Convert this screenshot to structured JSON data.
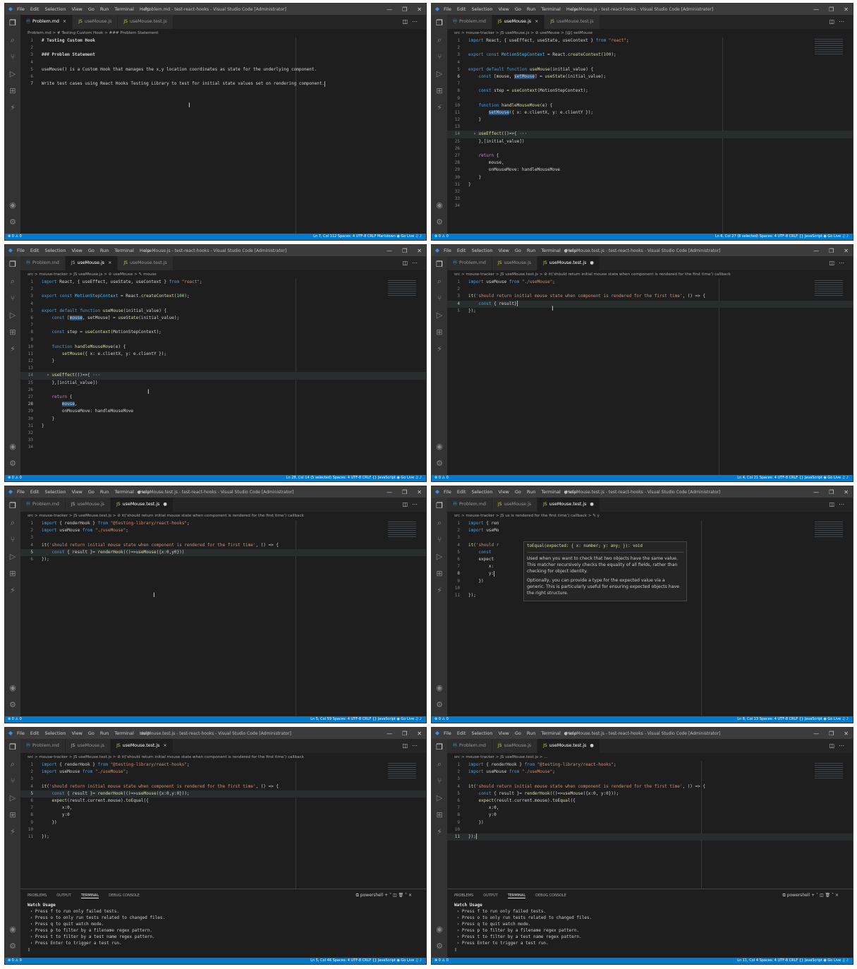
{
  "menu": [
    "File",
    "Edit",
    "Selection",
    "View",
    "Go",
    "Run",
    "Terminal",
    "Help"
  ],
  "panels": [
    {
      "title": "Problem.md - test-react-hooks - Visual Studio Code [Administrator]",
      "tabs": [
        {
          "label": "Problem.md",
          "type": "md",
          "active": true,
          "close": "×"
        },
        {
          "label": "useMouse.js",
          "type": "js",
          "active": false,
          "close": ""
        },
        {
          "label": "useMouse.test.js",
          "type": "js",
          "active": false,
          "close": ""
        }
      ],
      "breadcrumb": "Problem.md > # Testing Custom Hook > ### Problem Statement",
      "ruler": 390,
      "lines": [
        {
          "n": "1",
          "t": "# Testing Custom Hook",
          "c": "mdh"
        },
        {
          "n": "2",
          "t": ""
        },
        {
          "n": "3",
          "t": "### Problem Statement",
          "c": "mdh"
        },
        {
          "n": "4",
          "t": ""
        },
        {
          "n": "5",
          "t": "useMouse() is a Custom Hook that manages the x,y location coordinates as state for the underlying component."
        },
        {
          "n": "6",
          "t": ""
        },
        {
          "n": "7",
          "t": "Write test cases using React Hooks Testing Library to test for initial state values set on rendering component.",
          "cur": true,
          "caret": true
        }
      ],
      "status_left": "⊗ 0 ⚠ 0",
      "status_right": "Ln 7, Col 112   Spaces: 4   UTF-8   CRLF   Markdown   ◉ Go Live   ♫   ♪",
      "ibeam": [
        260,
        140
      ]
    },
    {
      "title": "useMouse.js - test-react-hooks - Visual Studio Code [Administrator]",
      "tabs": [
        {
          "label": "Problem.md",
          "type": "md",
          "active": false,
          "close": ""
        },
        {
          "label": "useMouse.js",
          "type": "js",
          "active": true,
          "close": "×"
        },
        {
          "label": "useMouse.test.js",
          "type": "js",
          "active": false,
          "close": ""
        }
      ],
      "breadcrumb": "src > mouse-tracker > JS useMouse.js > ⊘ useMouse > [@] setMouse",
      "ruler": 390,
      "lines": [
        {
          "n": "1",
          "h": "<span class='kw'>import</span> React, { useEffect, useState, useContext } <span class='kw'>from</span> <span class='str'>\"react\"</span>;"
        },
        {
          "n": "2",
          "t": ""
        },
        {
          "n": "3",
          "h": "<span class='kw'>export</span> <span class='kw'>const</span> <span class='cls'>MotionStepContext</span> = React.<span class='fn'>createContext</span>(<span class='num'>100</span>);"
        },
        {
          "n": "4",
          "t": ""
        },
        {
          "n": "5",
          "h": "<span class='kw'>export</span> <span class='kw'>default</span> <span class='kw'>function</span> <span class='fn'>useMouse</span>(initial_value) {"
        },
        {
          "n": "6",
          "cur": true,
          "h": "    <span class='kw'>const</span> [mouse, <span class='sel'>setMouse</span>] = <span class='fn'>useState</span>(initial_value);"
        },
        {
          "n": "7",
          "t": ""
        },
        {
          "n": "8",
          "h": "    <span class='kw'>const</span> step = <span class='fn'>useContext</span>(MotionStepContext);"
        },
        {
          "n": "9",
          "t": ""
        },
        {
          "n": "10",
          "h": "    <span class='kw'>function</span> <span class='fn'>handleMouseMove</span>(e) {"
        },
        {
          "n": "11",
          "h": "        <span class='sel'>setMouse</span>({ x: e.clientX, y: e.clientY });"
        },
        {
          "n": "12",
          "t": "    }"
        },
        {
          "n": "13",
          "t": ""
        },
        {
          "n": "14",
          "hl": true,
          "h": "  › <span class='fn'>useEffect</span>(()=>{ ···"
        },
        {
          "n": "25",
          "t": "    },[initial_value])"
        },
        {
          "n": "26",
          "t": ""
        },
        {
          "n": "27",
          "h": "    <span class='ctl2'>return</span> {"
        },
        {
          "n": "28",
          "t": "        mouse,"
        },
        {
          "n": "29",
          "t": "        onMouseMove: handleMouseMove"
        },
        {
          "n": "30",
          "t": "    }"
        },
        {
          "n": "31",
          "t": "}"
        },
        {
          "n": "32",
          "t": ""
        },
        {
          "n": "33",
          "t": ""
        },
        {
          "n": "34",
          "t": ""
        }
      ],
      "status_left": "⊗ 0 ⚠ 0",
      "status_right": "Ln 6, Col 27 (8 selected)   Spaces: 4   UTF-8   CRLF   {} JavaScript   ◉ Go Live   ♫   ♪",
      "minimap": true
    },
    {
      "title": "useMouse.js - test-react-hooks - Visual Studio Code [Administrator]",
      "tabs": [
        {
          "label": "Problem.md",
          "type": "md",
          "active": false,
          "close": ""
        },
        {
          "label": "useMouse.js",
          "type": "js",
          "active": true,
          "close": "×"
        },
        {
          "label": "useMouse.test.js",
          "type": "js",
          "active": false,
          "close": ""
        }
      ],
      "breadcrumb": "src > mouse-tracker > JS useMouse.js > ⊘ useMouse > ✎ mouse",
      "ruler": 390,
      "lines": [
        {
          "n": "1",
          "h": "<span class='kw'>import</span> React, { useEffect, useState, useContext } <span class='kw'>from</span> <span class='str'>\"react\"</span>;"
        },
        {
          "n": "2",
          "t": ""
        },
        {
          "n": "3",
          "h": "<span class='kw'>export</span> <span class='kw'>const</span> <span class='cls'>MotionStepContext</span> = React.<span class='fn'>createContext</span>(<span class='num'>100</span>);"
        },
        {
          "n": "4",
          "t": ""
        },
        {
          "n": "5",
          "h": "<span class='kw'>export</span> <span class='kw'>default</span> <span class='kw'>function</span> <span class='fn'>useMouse</span>(initial_value) {"
        },
        {
          "n": "6",
          "h": "    <span class='kw'>const</span> [<span class='sel'>mouse</span>, setMouse] = <span class='fn'>useState</span>(initial_value);"
        },
        {
          "n": "7",
          "t": ""
        },
        {
          "n": "8",
          "h": "    <span class='kw'>const</span> step = <span class='fn'>useContext</span>(MotionStepContext);"
        },
        {
          "n": "9",
          "t": ""
        },
        {
          "n": "10",
          "h": "    <span class='kw'>function</span> <span class='fn'>handleMouseMove</span>(e) {"
        },
        {
          "n": "11",
          "h": "        <span class='fn'>setMouse</span>({ x: e.clientX, y: e.clientY });"
        },
        {
          "n": "12",
          "t": "    }"
        },
        {
          "n": "13",
          "t": ""
        },
        {
          "n": "14",
          "hl": true,
          "h": "  › <span class='fn'>useEffect</span>(()=>{ ···"
        },
        {
          "n": "25",
          "t": "    },[initial_value])"
        },
        {
          "n": "26",
          "t": ""
        },
        {
          "n": "27",
          "h": "    <span class='ctl2'>return</span> {"
        },
        {
          "n": "28",
          "cur": true,
          "h": "        <span class='sel'>mouse</span>,"
        },
        {
          "n": "29",
          "t": "        onMouseMove: handleMouseMove"
        },
        {
          "n": "30",
          "t": "    }"
        },
        {
          "n": "31",
          "t": "}"
        },
        {
          "n": "32",
          "t": ""
        },
        {
          "n": "33",
          "t": ""
        },
        {
          "n": "34",
          "t": ""
        }
      ],
      "status_left": "⊗ 0 ⚠ 0",
      "status_right": "Ln 28, Col 14 (5 selected)   Spaces: 4   UTF-8   CRLF   {} JavaScript   ◉ Go Live   ♫   ♪",
      "minimap": true,
      "ibeam": [
        202,
        204
      ]
    },
    {
      "title": "● useMouse.test.js - test-react-hooks - Visual Studio Code [Administrator]",
      "tabs": [
        {
          "label": "Problem.md",
          "type": "md",
          "active": false,
          "close": ""
        },
        {
          "label": "useMouse.js",
          "type": "js",
          "active": false,
          "close": ""
        },
        {
          "label": "useMouse.test.js",
          "type": "js",
          "active": true,
          "close": "●"
        }
      ],
      "breadcrumb": "src > mouse-tracker > JS useMouse.test.js > ⊘ it('should return initial mouse state when component is rendered for the first time') callback",
      "ruler": 385,
      "lines": [
        {
          "n": "1",
          "h": "<span class='kw'>import</span> useMouse <span class='kw'>from</span> <span class='str'>\"./useMouse\"</span>;"
        },
        {
          "n": "2",
          "t": ""
        },
        {
          "n": "3",
          "h": "<span class='fn'>it</span>(<span class='str'>'should return initial mouse state when component is rendered for the first time'</span>, () => {"
        },
        {
          "n": "4",
          "cur": true,
          "hl": true,
          "caret": true,
          "h": "    <span class='kw'>const</span> { result}"
        },
        {
          "n": "5",
          "t": "});"
        }
      ],
      "status_left": "⊗ 0 ⚠ 0",
      "status_right": "Ln 4, Col 21   Spaces: 4   UTF-8   CRLF   {} JavaScript   ◉ Go Live   ♫   ♪",
      "minimap": true,
      "ibeam": [
        170,
        86
      ]
    },
    {
      "title": "● useMouse.test.js - test-react-hooks - Visual Studio Code [Administrator]",
      "tabs": [
        {
          "label": "Problem.md",
          "type": "md",
          "active": false,
          "close": ""
        },
        {
          "label": "useMouse.js",
          "type": "js",
          "active": false,
          "close": ""
        },
        {
          "label": "useMouse.test.js",
          "type": "js",
          "active": true,
          "close": "●"
        }
      ],
      "breadcrumb": "src > mouse-tracker > JS useMouse.test.js > ⊘ it('should return initial mouse state when component is rendered for the first time') callback",
      "ruler": 390,
      "lines": [
        {
          "n": "1",
          "h": "<span class='kw'>import</span> { renderHook } <span class='kw'>from</span> <span class='str'>\"@testing-library/react-hooks\"</span>;"
        },
        {
          "n": "2",
          "h": "<span class='kw'>import</span> useMouse <span class='kw'>from</span> <span class='str'>\"./useMouse\"</span>;"
        },
        {
          "n": "3",
          "t": ""
        },
        {
          "n": "4",
          "h": "<span class='fn'>it</span>(<span class='str'>'should return initial mouse state when component is rendered for the first time'</span>, () => {"
        },
        {
          "n": "5",
          "cur": true,
          "hl": true,
          "h": "    <span class='kw'>const</span> { result }= <span class='fn'>renderHook</span>(()=><span class='fn'>useMouse</span>({x:0,y0}))"
        },
        {
          "n": "6",
          "t": "});"
        }
      ],
      "status_left": "⊗ 0 ⚠ 0",
      "status_right": "Ln 5, Col 59   Spaces: 4   UTF-8   CRLF   {} JavaScript   ◉ Go Live   ♫   ♪",
      "minimap": true,
      "ibeam": [
        210,
        150
      ]
    },
    {
      "title": "● useMouse.test.js - test-react-hooks - Visual Studio Code [Administrator]",
      "tabs": [
        {
          "label": "Problem.md",
          "type": "md",
          "active": false,
          "close": ""
        },
        {
          "label": "useMouse.js",
          "type": "js",
          "active": false,
          "close": ""
        },
        {
          "label": "useMouse.test.js",
          "type": "js",
          "active": true,
          "close": "●"
        }
      ],
      "breadcrumb": "src > mouse-tracker > JS us                                                                                  is rendered for the first time') callback > ✎ y",
      "ruler": 360,
      "lines": [
        {
          "n": "1",
          "h": "<span class='kw'>import</span> { ren"
        },
        {
          "n": "2",
          "h": "<span class='kw'>import</span> useMo"
        },
        {
          "n": "3",
          "t": ""
        },
        {
          "n": "4",
          "h": "<span class='fn'>it</span>(<span class='str'>'should r                                              the first time'</span>, () => {"
        },
        {
          "n": "5",
          "h": "    <span class='kw'>const</span>"
        },
        {
          "n": "6",
          "h": "    expect"
        },
        {
          "n": "7",
          "t": "        x:"
        },
        {
          "n": "8",
          "cur": true,
          "caret": true,
          "t": "        y:"
        },
        {
          "n": "9",
          "t": "    })"
        },
        {
          "n": "10",
          "t": ""
        },
        {
          "n": "11",
          "t": "});"
        }
      ],
      "hover": {
        "signature": "toEqual(expected: { x: number; y: any; }): void",
        "p1": "Used when you want to check that two objects have the same value. This matcher recursively checks the equality of all fields, rather than checking for object identity.",
        "p2": "Optionally, you can provide a type for the expected value via a generic. This is particularly useful for ensuring expected objects have the right structure."
      },
      "status_left": "⊗ 0 ⚠ 0",
      "status_right": "Ln 8, Col 13   Spaces: 4   UTF-8   CRLF   {} JavaScript   ◉ Go Live   ♫   ♪",
      "minimap": true
    },
    {
      "title": "useMouse.test.js - test-react-hooks - Visual Studio Code [Administrator]",
      "tabs": [
        {
          "label": "Problem.md",
          "type": "md",
          "active": false,
          "close": ""
        },
        {
          "label": "useMouse.js",
          "type": "js",
          "active": false,
          "close": ""
        },
        {
          "label": "useMouse.test.js",
          "type": "js",
          "active": true,
          "close": "×"
        }
      ],
      "breadcrumb": "src > mouse-tracker > JS useMouse.test.js > ⊘ it('should return initial mouse state when component is rendered for the first time') callback",
      "ruler": 390,
      "lines": [
        {
          "n": "1",
          "h": "<span class='kw'>import</span> { renderHook } <span class='kw'>from</span> <span class='str'>\"@testing-library/react-hooks\"</span>;"
        },
        {
          "n": "2",
          "h": "<span class='kw'>import</span> useMouse <span class='kw'>from</span> <span class='str'>\"./useMouse\"</span>;"
        },
        {
          "n": "3",
          "t": ""
        },
        {
          "n": "4",
          "h": "<span class='fn'>it</span>(<span class='str'>'should return initial mouse state when component is rendered for the first time'</span>, () => {"
        },
        {
          "n": "5",
          "cur": true,
          "hl": true,
          "h": "    <span class='kw'>const</span> { result }= <span class='fn'>renderHook</span>(()=><span class='fn'>useMouse</span>({x:0,y:0}));"
        },
        {
          "n": "6",
          "h": "    <span class='fn'>expect</span>(result.current.mouse).<span class='fn'>toEqual</span>({"
        },
        {
          "n": "7",
          "t": "        x:0,"
        },
        {
          "n": "8",
          "t": "        y:0"
        },
        {
          "n": "9",
          "t": "    })"
        },
        {
          "n": "10",
          "t": ""
        },
        {
          "n": "11",
          "t": "});"
        }
      ],
      "terminal": {
        "tabs": [
          "PROBLEMS",
          "OUTPUT",
          "TERMINAL",
          "DEBUG CONSOLE"
        ],
        "shell": "⧉ powershell  + ˅  ◫  🗑  ˄  ×",
        "lines": [
          "Watch Usage",
          " › Press f to run only failed tests.",
          " › Press o to only run tests related to changed files.",
          " › Press q to quit watch mode.",
          " › Press p to filter by a filename regex pattern.",
          " › Press t to filter by a test name regex pattern.",
          " › Press Enter to trigger a test run.",
          "▯"
        ]
      },
      "status_left": "⊗ 0 ⚠ 0",
      "status_right": "Ln 5, Col 46   Spaces: 4   UTF-8   CRLF   {} JavaScript   ◉ Go Live   ♫   ♪",
      "minimap": true
    },
    {
      "title": "● useMouse.test.js - test-react-hooks - Visual Studio Code [Administrator]",
      "tabs": [
        {
          "label": "Problem.md",
          "type": "md",
          "active": false,
          "close": ""
        },
        {
          "label": "useMouse.js",
          "type": "js",
          "active": false,
          "close": ""
        },
        {
          "label": "useMouse.test.js",
          "type": "js",
          "active": true,
          "close": "●"
        }
      ],
      "breadcrumb": "src > mouse-tracker > JS useMouse.test.js > ...",
      "ruler": 360,
      "lines": [
        {
          "n": "1",
          "h": "<span class='kw'>import</span> { renderHook } <span class='kw'>from</span> <span class='str'>\"@testing-library/react-hooks\"</span>;"
        },
        {
          "n": "2",
          "h": "<span class='kw'>import</span> useMouse <span class='kw'>from</span> <span class='str'>\"./useMouse\"</span>;"
        },
        {
          "n": "3",
          "t": ""
        },
        {
          "n": "4",
          "h": "<span class='fn'>it</span>(<span class='str'>'should return initial mouse state when component is rendered for the first time'</span>, () => {"
        },
        {
          "n": "5",
          "h": "    <span class='kw'>const</span> { result }= <span class='fn'>renderHook</span>(()=><span class='fn'>useMouse</span>({x:0, y:0}));"
        },
        {
          "n": "6",
          "h": "    <span class='fn'>expect</span>(result.current.mouse).<span class='fn'>toEqual</span>({"
        },
        {
          "n": "7",
          "t": "        x:0,"
        },
        {
          "n": "8",
          "t": "        y:0"
        },
        {
          "n": "9",
          "t": "    })"
        },
        {
          "n": "10",
          "t": ""
        },
        {
          "n": "11",
          "cur": true,
          "hl": true,
          "caret": true,
          "t": "});"
        }
      ],
      "terminal": {
        "tabs": [
          "PROBLEMS",
          "OUTPUT",
          "TERMINAL",
          "DEBUG CONSOLE"
        ],
        "shell": "⧉ powershell  + ˅  ◫  🗑  ˄  ×",
        "lines": [
          "Watch Usage",
          " › Press f to run only failed tests.",
          " › Press o to only run tests related to changed files.",
          " › Press q to quit watch mode.",
          " › Press p to filter by a filename regex pattern.",
          " › Press t to filter by a test name regex pattern.",
          " › Press Enter to trigger a test run.",
          "▯"
        ]
      },
      "status_left": "⊗ 0 ⚠ 0",
      "status_right": "Ln 11, Col 4   Spaces: 4   UTF-8   CRLF   {} JavaScript   ◉ Go Live   ♫   ♪",
      "minimap": true,
      "ibeam": [
        790,
        176
      ]
    }
  ],
  "icons": [
    "explorer-icon",
    "search-icon",
    "source-control-icon",
    "run-debug-icon",
    "extensions-icon",
    "live-share-icon"
  ],
  "accent": "#007acc"
}
